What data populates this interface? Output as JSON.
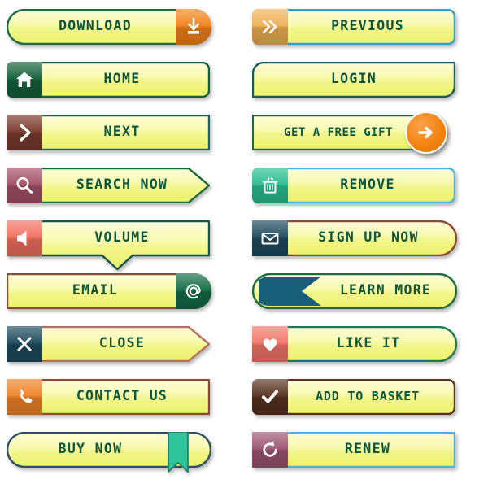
{
  "page": {
    "title": "Web Button Set",
    "background": "#ffffff",
    "label_color": "#0e5637",
    "body_fill_top": "#fbfcc4",
    "body_fill_bottom": "#eef36e"
  },
  "columns": [
    {
      "name": "left-column",
      "buttons": [
        {
          "id": "download",
          "label": "DOWNLOAD",
          "icon": "download-icon",
          "icon_position": "right",
          "icon_color": "#f3821a",
          "border_color": "#1d6b3e",
          "shape": "pill",
          "accent": "#f3821a"
        },
        {
          "id": "home",
          "label": "HOME",
          "icon": "home-icon",
          "icon_position": "left",
          "icon_color": "#14603a",
          "border_color": "#14603a",
          "shape": "rounded",
          "accent": "#14603a"
        },
        {
          "id": "next",
          "label": "NEXT",
          "icon": "chevron-right-icon",
          "icon_position": "left",
          "icon_color": "#7a3b2c",
          "border_color": "#1a6468",
          "shape": "rect",
          "accent": "#7a3b2c"
        },
        {
          "id": "search-now",
          "label": "SEARCH NOW",
          "icon": "search-icon",
          "icon_position": "left",
          "icon_color": "#a35068",
          "border_color": "#1d6b3e",
          "shape": "arrow-right",
          "accent": "#a35068"
        },
        {
          "id": "volume",
          "label": "VOLUME",
          "icon": "speaker-icon",
          "icon_position": "left",
          "icon_color": "#f0705e",
          "border_color": "#16554a",
          "shape": "speech-bubble",
          "accent": "#f0705e"
        },
        {
          "id": "email",
          "label": "EMAIL",
          "icon": "at-sign-icon",
          "icon_position": "right",
          "icon_color": "#136b45",
          "border_color": "#8d4a33",
          "shape": "round-right",
          "accent": "#136b45"
        },
        {
          "id": "close",
          "label": "CLOSE",
          "icon": "close-x-icon",
          "icon_position": "left",
          "icon_color": "#1d4a5e",
          "border_color": "#b2705e",
          "shape": "arrow-right",
          "accent": "#1d4a5e"
        },
        {
          "id": "contact-us",
          "label": "CONTACT US",
          "icon": "phone-icon",
          "icon_position": "left",
          "icon_color": "#ef8328",
          "border_color": "#8d4a33",
          "shape": "rect",
          "accent": "#ef8328"
        },
        {
          "id": "buy-now",
          "label": "BUY NOW",
          "icon": "bookmark-ribbon-icon",
          "icon_position": "right-decor",
          "icon_color": "#2fc39a",
          "border_color": "#2f4f66",
          "shape": "pill",
          "accent": "#2fc39a"
        }
      ]
    },
    {
      "name": "right-column",
      "buttons": [
        {
          "id": "previous",
          "label": "PREVIOUS",
          "icon": "double-chevron-icon",
          "icon_position": "left",
          "icon_color": "#efb054",
          "border_color": "#2f9fd0",
          "shape": "rounded",
          "accent": "#efb054"
        },
        {
          "id": "login",
          "label": "LOGIN",
          "icon": "none",
          "icon_position": "none",
          "icon_color": "",
          "border_color": "#1a5c66",
          "shape": "diagonal-round",
          "accent": "#1a5c66"
        },
        {
          "id": "get-a-free-gift",
          "label": "GET A FREE GIFT",
          "icon": "arrow-circle-right-icon",
          "icon_position": "circle-right",
          "icon_color": "#f2820f",
          "border_color": "#1d6b3e",
          "shape": "rect",
          "accent": "#f2820f"
        },
        {
          "id": "remove",
          "label": "REMOVE",
          "icon": "trash-icon",
          "icon_position": "left",
          "icon_color": "#2bbf90",
          "border_color": "#4fb0e0",
          "shape": "rounded",
          "accent": "#2bbf90"
        },
        {
          "id": "sign-up-now",
          "label": "SIGN UP NOW",
          "icon": "envelope-icon",
          "icon_position": "left",
          "icon_color": "#1d4a5e",
          "border_color": "#8d4a33",
          "shape": "round-right",
          "accent": "#1d4a5e"
        },
        {
          "id": "learn-more",
          "label": "LEARN MORE",
          "icon": "ribbon-left-icon",
          "icon_position": "left-decor",
          "icon_color": "#1a5f7a",
          "border_color": "#1d6b3e",
          "shape": "pill",
          "accent": "#1a5f7a"
        },
        {
          "id": "like-it",
          "label": "LIKE IT",
          "icon": "heart-icon",
          "icon_position": "left",
          "icon_color": "#f4766a",
          "border_color": "#1d7a57",
          "shape": "round-right",
          "accent": "#f4766a"
        },
        {
          "id": "add-to-basket",
          "label": "ADD TO BASKET",
          "icon": "check-icon",
          "icon_position": "left",
          "icon_color": "#57321f",
          "border_color": "#57321f",
          "shape": "rounded",
          "accent": "#57321f"
        },
        {
          "id": "renew",
          "label": "RENEW",
          "icon": "refresh-icon",
          "icon_position": "left",
          "icon_color": "#9e5470",
          "border_color": "#4fb0e0",
          "shape": "rect",
          "accent": "#9e5470"
        }
      ]
    }
  ]
}
